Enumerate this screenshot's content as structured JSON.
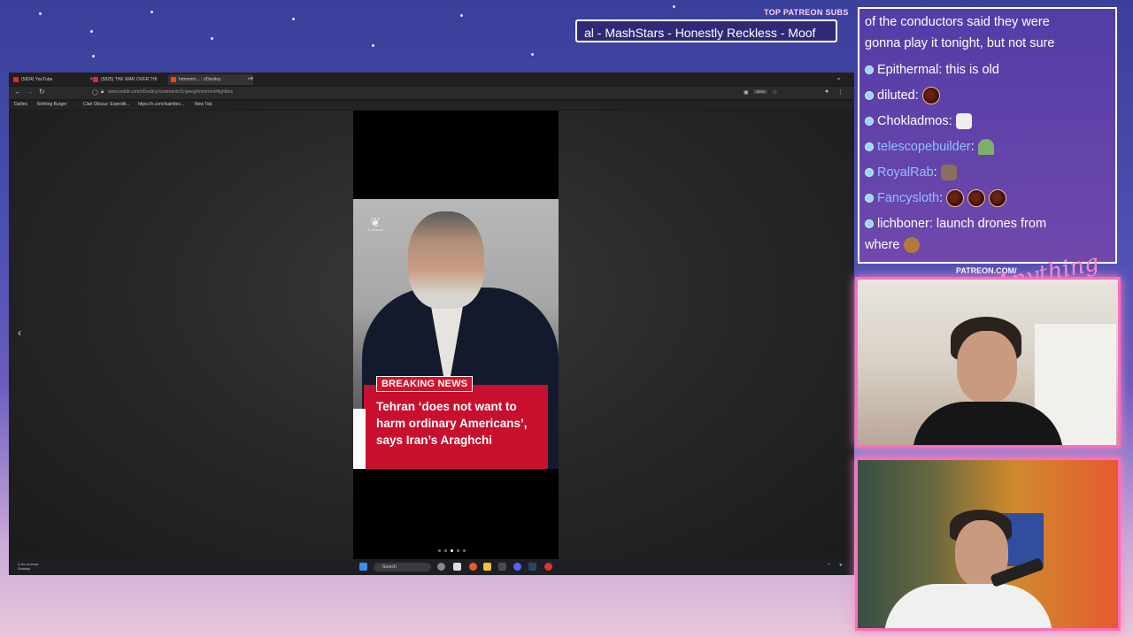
{
  "overlay": {
    "patreon_label": "TOP PATREON SUBS",
    "patreon_ticker": "al - MashStars - Honestly Reckless - Moof",
    "patreon_url": "PATREON.COM/",
    "patreon_script": "Anything Else"
  },
  "browser": {
    "tabs": [
      {
        "label": "(5824) YouTube"
      },
      {
        "label": "(5825) THE WAR OVER THI"
      },
      {
        "label": "hmmmm... : r/Destiny"
      }
    ],
    "url": "www.reddit.com/r/Destiny/comments/1ngeeg/hmmmm/#lightbox",
    "zoom": "100%",
    "bookmarks": [
      "Dailies",
      "Nothing Burger",
      "Clair Obscur: Expediti...",
      "https://x.com/isainttec...",
      "New Tab"
    ]
  },
  "video": {
    "logo": "AL JAZEERA",
    "badge": "BREAKING NEWS",
    "headline": "Tehran ‘does not want to harm ordinary Americans’, says Iran’s Araghchi"
  },
  "taskbar": {
    "weather": "4 cm of snow",
    "weather_day": "Sunday",
    "search_placeholder": "Search"
  },
  "chat": {
    "messages": [
      {
        "text": "of the conductors said they were"
      },
      {
        "text": "gonna play it tonight, but not sure"
      },
      {
        "user": "Epithermal",
        "text": "this is old"
      },
      {
        "user": "diluted",
        "text": ""
      },
      {
        "user": "Chokladmos",
        "text": ""
      },
      {
        "user": "telescopebuilder",
        "text": ""
      },
      {
        "user": "RoyalRab",
        "text": ""
      },
      {
        "user": "Fancysloth",
        "text": ""
      },
      {
        "user": "lichboner",
        "text": "launch drones from"
      },
      {
        "text": "where"
      }
    ]
  },
  "colors": {
    "accent_pink": "#ff6fb5",
    "breaking_red": "#c8102e",
    "chat_user_blue": "#8fc0ff"
  }
}
